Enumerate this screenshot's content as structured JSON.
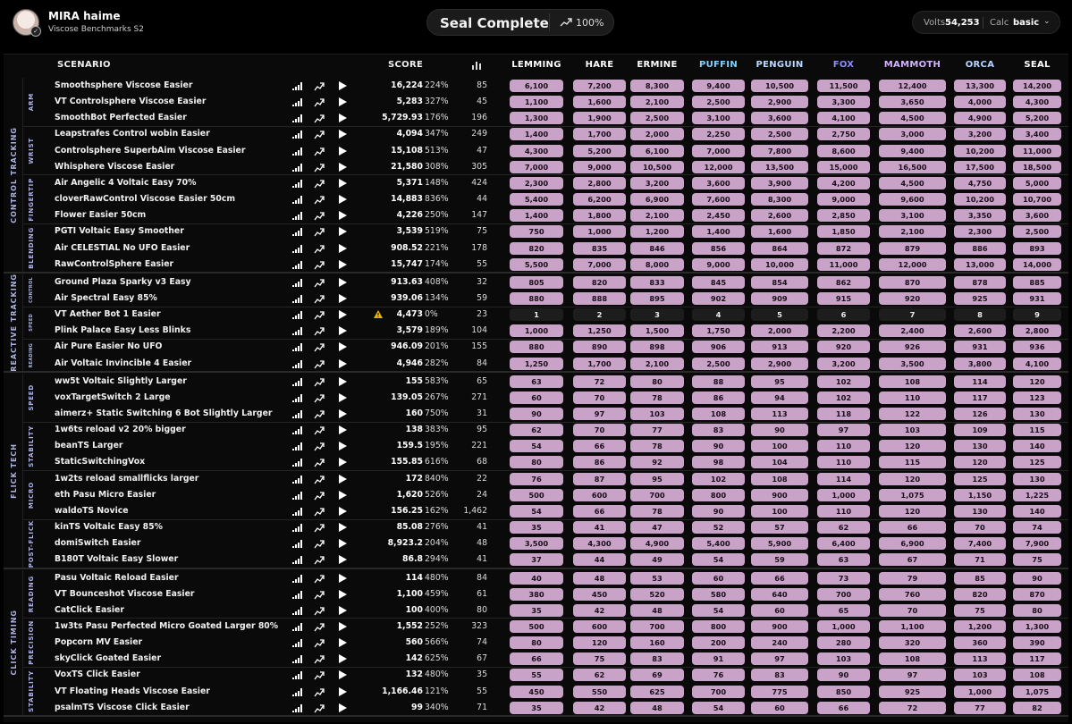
{
  "user": {
    "name": "MIRA haime",
    "subtitle": "Viscose Benchmarks S2",
    "badge": "✓"
  },
  "rank": {
    "title": "Seal Complete",
    "progress": "100%"
  },
  "stats": {
    "volts_label": "Volts",
    "volts_value": "54,253",
    "calc_label": "Calc",
    "calc_value": "basic"
  },
  "columns": {
    "scenario": "SCENARIO",
    "score": "SCORE"
  },
  "rank_names": [
    "LEMMING",
    "HARE",
    "ERMINE",
    "PUFFIN",
    "PENGUIN",
    "FOX",
    "MAMMOTH",
    "ORCA",
    "SEAL"
  ],
  "rank_colors": [
    "#ffffff",
    "#ffffff",
    "#ffffff",
    "#7fd3ff",
    "#b9d9ff",
    "#8d8dff",
    "#d4b4ff",
    "#b6d4ff",
    "#ffffff"
  ],
  "colors": {
    "cell": "#c9a2c8",
    "group_label": "#aeb3e2"
  },
  "groups": [
    {
      "name": "CONTROL TRACKING",
      "subgroups": [
        {
          "name": "ARM",
          "rows": [
            {
              "scenario": "Smoothsphere Viscose Easier",
              "score": "16,224",
              "pct": "224%",
              "rank": "85",
              "thresholds": [
                "6,100",
                "7,200",
                "8,300",
                "9,400",
                "10,500",
                "11,500",
                "12,400",
                "13,300",
                "14,200"
              ]
            },
            {
              "scenario": "VT Controlsphere Viscose Easier",
              "score": "5,283",
              "pct": "327%",
              "rank": "45",
              "thresholds": [
                "1,100",
                "1,600",
                "2,100",
                "2,500",
                "2,900",
                "3,300",
                "3,650",
                "4,000",
                "4,300"
              ]
            },
            {
              "scenario": "SmoothBot Perfected Easier",
              "score": "5,729.93",
              "pct": "176%",
              "rank": "196",
              "thresholds": [
                "1,300",
                "1,900",
                "2,500",
                "3,100",
                "3,600",
                "4,100",
                "4,500",
                "4,900",
                "5,200"
              ]
            }
          ]
        },
        {
          "name": "WRIST",
          "rows": [
            {
              "scenario": "Leapstrafes Control wobin Easier",
              "score": "4,094",
              "pct": "347%",
              "rank": "249",
              "thresholds": [
                "1,400",
                "1,700",
                "2,000",
                "2,250",
                "2,500",
                "2,750",
                "3,000",
                "3,200",
                "3,400"
              ]
            },
            {
              "scenario": "Controlsphere SuperbAim Viscose Easier",
              "score": "15,108",
              "pct": "513%",
              "rank": "47",
              "thresholds": [
                "4,300",
                "5,200",
                "6,100",
                "7,000",
                "7,800",
                "8,600",
                "9,400",
                "10,200",
                "11,000"
              ]
            },
            {
              "scenario": "Whisphere Viscose Easier",
              "score": "21,580",
              "pct": "308%",
              "rank": "305",
              "thresholds": [
                "7,000",
                "9,000",
                "10,500",
                "12,000",
                "13,500",
                "15,000",
                "16,500",
                "17,500",
                "18,500"
              ]
            }
          ]
        },
        {
          "name": "FINGERTIP",
          "rows": [
            {
              "scenario": "Air Angelic 4 Voltaic Easy 70%",
              "score": "5,371",
              "pct": "148%",
              "rank": "424",
              "thresholds": [
                "2,300",
                "2,800",
                "3,200",
                "3,600",
                "3,900",
                "4,200",
                "4,500",
                "4,750",
                "5,000"
              ]
            },
            {
              "scenario": "cloverRawControl Viscose Easier 50cm",
              "score": "14,883",
              "pct": "836%",
              "rank": "44",
              "thresholds": [
                "5,400",
                "6,200",
                "6,900",
                "7,600",
                "8,300",
                "9,000",
                "9,600",
                "10,200",
                "10,700"
              ]
            },
            {
              "scenario": "Flower Easier 50cm",
              "score": "4,226",
              "pct": "250%",
              "rank": "147",
              "thresholds": [
                "1,400",
                "1,800",
                "2,100",
                "2,450",
                "2,600",
                "2,850",
                "3,100",
                "3,350",
                "3,600"
              ]
            }
          ]
        },
        {
          "name": "BLENDING",
          "rows": [
            {
              "scenario": "PGTI Voltaic Easy Smoother",
              "score": "3,539",
              "pct": "519%",
              "rank": "75",
              "thresholds": [
                "750",
                "1,000",
                "1,200",
                "1,400",
                "1,600",
                "1,850",
                "2,100",
                "2,300",
                "2,500"
              ]
            },
            {
              "scenario": "Air CELESTIAL No UFO Easier",
              "score": "908.52",
              "pct": "221%",
              "rank": "178",
              "thresholds": [
                "820",
                "835",
                "846",
                "856",
                "864",
                "872",
                "879",
                "886",
                "893"
              ]
            },
            {
              "scenario": "RawControlSphere Easier",
              "score": "15,747",
              "pct": "174%",
              "rank": "55",
              "thresholds": [
                "5,500",
                "7,000",
                "8,000",
                "9,000",
                "10,000",
                "11,000",
                "12,000",
                "13,000",
                "14,000"
              ]
            }
          ]
        }
      ]
    },
    {
      "name": "REACTIVE TRACKING",
      "subgroups": [
        {
          "name": "CONTROL",
          "tiny": true,
          "rows": [
            {
              "scenario": "Ground Plaza Sparky v3 Easy",
              "score": "913.63",
              "pct": "408%",
              "rank": "32",
              "thresholds": [
                "805",
                "820",
                "833",
                "845",
                "854",
                "862",
                "870",
                "878",
                "885"
              ]
            },
            {
              "scenario": "Air Spectral Easy 85%",
              "score": "939.06",
              "pct": "134%",
              "rank": "59",
              "thresholds": [
                "880",
                "888",
                "895",
                "902",
                "909",
                "915",
                "920",
                "925",
                "931"
              ]
            }
          ]
        },
        {
          "name": "SPEED",
          "tiny": true,
          "rows": [
            {
              "scenario": "VT Aether Bot 1 Easier",
              "score": "4,473",
              "pct": "0%",
              "rank": "23",
              "warn": true,
              "dark": true,
              "thresholds": [
                "1",
                "2",
                "3",
                "4",
                "5",
                "6",
                "7",
                "8",
                "9"
              ]
            },
            {
              "scenario": "Plink Palace Easy Less Blinks",
              "score": "3,579",
              "pct": "189%",
              "rank": "104",
              "thresholds": [
                "1,000",
                "1,250",
                "1,500",
                "1,750",
                "2,000",
                "2,200",
                "2,400",
                "2,600",
                "2,800"
              ]
            }
          ]
        },
        {
          "name": "READING",
          "tiny": true,
          "rows": [
            {
              "scenario": "Air Pure Easier No UFO",
              "score": "946.09",
              "pct": "201%",
              "rank": "155",
              "thresholds": [
                "880",
                "890",
                "898",
                "906",
                "913",
                "920",
                "926",
                "931",
                "936"
              ]
            },
            {
              "scenario": "Air Voltaic Invincible 4 Easier",
              "score": "4,946",
              "pct": "282%",
              "rank": "84",
              "thresholds": [
                "1,250",
                "1,700",
                "2,100",
                "2,500",
                "2,900",
                "3,200",
                "3,500",
                "3,800",
                "4,100"
              ]
            }
          ]
        }
      ]
    },
    {
      "name": "FLICK TECH",
      "subgroups": [
        {
          "name": "SPEED",
          "rows": [
            {
              "scenario": "ww5t Voltaic Slightly Larger",
              "score": "155",
              "pct": "583%",
              "rank": "65",
              "thresholds": [
                "63",
                "72",
                "80",
                "88",
                "95",
                "102",
                "108",
                "114",
                "120"
              ]
            },
            {
              "scenario": "voxTargetSwitch 2 Large",
              "score": "139.05",
              "pct": "267%",
              "rank": "271",
              "thresholds": [
                "60",
                "70",
                "78",
                "86",
                "94",
                "102",
                "110",
                "117",
                "123"
              ]
            },
            {
              "scenario": "aimerz+ Static Switching 6 Bot Slightly Larger",
              "score": "160",
              "pct": "750%",
              "rank": "31",
              "thresholds": [
                "90",
                "97",
                "103",
                "108",
                "113",
                "118",
                "122",
                "126",
                "130"
              ]
            }
          ]
        },
        {
          "name": "STABILITY",
          "rows": [
            {
              "scenario": "1w6ts reload v2 20% bigger",
              "score": "138",
              "pct": "383%",
              "rank": "95",
              "thresholds": [
                "62",
                "70",
                "77",
                "83",
                "90",
                "97",
                "103",
                "109",
                "115"
              ]
            },
            {
              "scenario": "beanTS Larger",
              "score": "159.5",
              "pct": "195%",
              "rank": "221",
              "thresholds": [
                "54",
                "66",
                "78",
                "90",
                "100",
                "110",
                "120",
                "130",
                "140"
              ]
            },
            {
              "scenario": "StaticSwitchingVox",
              "score": "155.85",
              "pct": "616%",
              "rank": "68",
              "thresholds": [
                "80",
                "86",
                "92",
                "98",
                "104",
                "110",
                "115",
                "120",
                "125"
              ]
            }
          ]
        },
        {
          "name": "MICRO",
          "rows": [
            {
              "scenario": "1w2ts reload smallflicks larger",
              "score": "172",
              "pct": "840%",
              "rank": "22",
              "thresholds": [
                "76",
                "87",
                "95",
                "102",
                "108",
                "114",
                "120",
                "125",
                "130"
              ]
            },
            {
              "scenario": "eth Pasu Micro Easier",
              "score": "1,620",
              "pct": "526%",
              "rank": "24",
              "thresholds": [
                "500",
                "600",
                "700",
                "800",
                "900",
                "1,000",
                "1,075",
                "1,150",
                "1,225"
              ]
            },
            {
              "scenario": "waldoTS Novice",
              "score": "156.25",
              "pct": "162%",
              "rank": "1,462",
              "thresholds": [
                "54",
                "66",
                "78",
                "90",
                "100",
                "110",
                "120",
                "130",
                "140"
              ]
            }
          ]
        },
        {
          "name": "POST-FLICK",
          "rows": [
            {
              "scenario": "kinTS Voltaic Easy 85%",
              "score": "85.08",
              "pct": "276%",
              "rank": "41",
              "thresholds": [
                "35",
                "41",
                "47",
                "52",
                "57",
                "62",
                "66",
                "70",
                "74"
              ]
            },
            {
              "scenario": "domiSwitch Easier",
              "score": "8,923.2",
              "pct": "204%",
              "rank": "48",
              "thresholds": [
                "3,500",
                "4,300",
                "4,900",
                "5,400",
                "5,900",
                "6,400",
                "6,900",
                "7,400",
                "7,900"
              ]
            },
            {
              "scenario": "B180T Voltaic Easy Slower",
              "score": "86.8",
              "pct": "294%",
              "rank": "41",
              "thresholds": [
                "37",
                "44",
                "49",
                "54",
                "59",
                "63",
                "67",
                "71",
                "75"
              ]
            }
          ]
        }
      ]
    },
    {
      "name": "CLICK TIMING",
      "subgroups": [
        {
          "name": "READING",
          "rows": [
            {
              "scenario": "Pasu Voltaic Reload Easier",
              "score": "114",
              "pct": "480%",
              "rank": "84",
              "thresholds": [
                "40",
                "48",
                "53",
                "60",
                "66",
                "73",
                "79",
                "85",
                "90"
              ]
            },
            {
              "scenario": "VT Bounceshot Viscose Easier",
              "score": "1,100",
              "pct": "459%",
              "rank": "61",
              "thresholds": [
                "380",
                "450",
                "520",
                "580",
                "640",
                "700",
                "760",
                "820",
                "870"
              ]
            },
            {
              "scenario": "CatClick Easier",
              "score": "100",
              "pct": "400%",
              "rank": "80",
              "thresholds": [
                "35",
                "42",
                "48",
                "54",
                "60",
                "65",
                "70",
                "75",
                "80"
              ]
            }
          ]
        },
        {
          "name": "PRECISION",
          "rows": [
            {
              "scenario": "1w3ts Pasu Perfected Micro Goated Larger 80%",
              "score": "1,552",
              "pct": "252%",
              "rank": "323",
              "thresholds": [
                "500",
                "600",
                "700",
                "800",
                "900",
                "1,000",
                "1,100",
                "1,200",
                "1,300"
              ]
            },
            {
              "scenario": "Popcorn MV Easier",
              "score": "560",
              "pct": "566%",
              "rank": "74",
              "thresholds": [
                "80",
                "120",
                "160",
                "200",
                "240",
                "280",
                "320",
                "360",
                "390"
              ]
            },
            {
              "scenario": "skyClick Goated Easier",
              "score": "142",
              "pct": "625%",
              "rank": "67",
              "thresholds": [
                "66",
                "75",
                "83",
                "91",
                "97",
                "103",
                "108",
                "113",
                "117"
              ]
            }
          ]
        },
        {
          "name": "STABILITY",
          "rows": [
            {
              "scenario": "VoxTS Click Easier",
              "score": "132",
              "pct": "480%",
              "rank": "35",
              "thresholds": [
                "55",
                "62",
                "69",
                "76",
                "83",
                "90",
                "97",
                "103",
                "108"
              ]
            },
            {
              "scenario": "VT Floating Heads Viscose Easier",
              "score": "1,166.46",
              "pct": "121%",
              "rank": "55",
              "thresholds": [
                "450",
                "550",
                "625",
                "700",
                "775",
                "850",
                "925",
                "1,000",
                "1,075"
              ]
            },
            {
              "scenario": "psalmTS Viscose Click Easier",
              "score": "99",
              "pct": "340%",
              "rank": "71",
              "thresholds": [
                "35",
                "42",
                "48",
                "54",
                "60",
                "66",
                "72",
                "77",
                "82"
              ]
            }
          ]
        }
      ]
    }
  ]
}
